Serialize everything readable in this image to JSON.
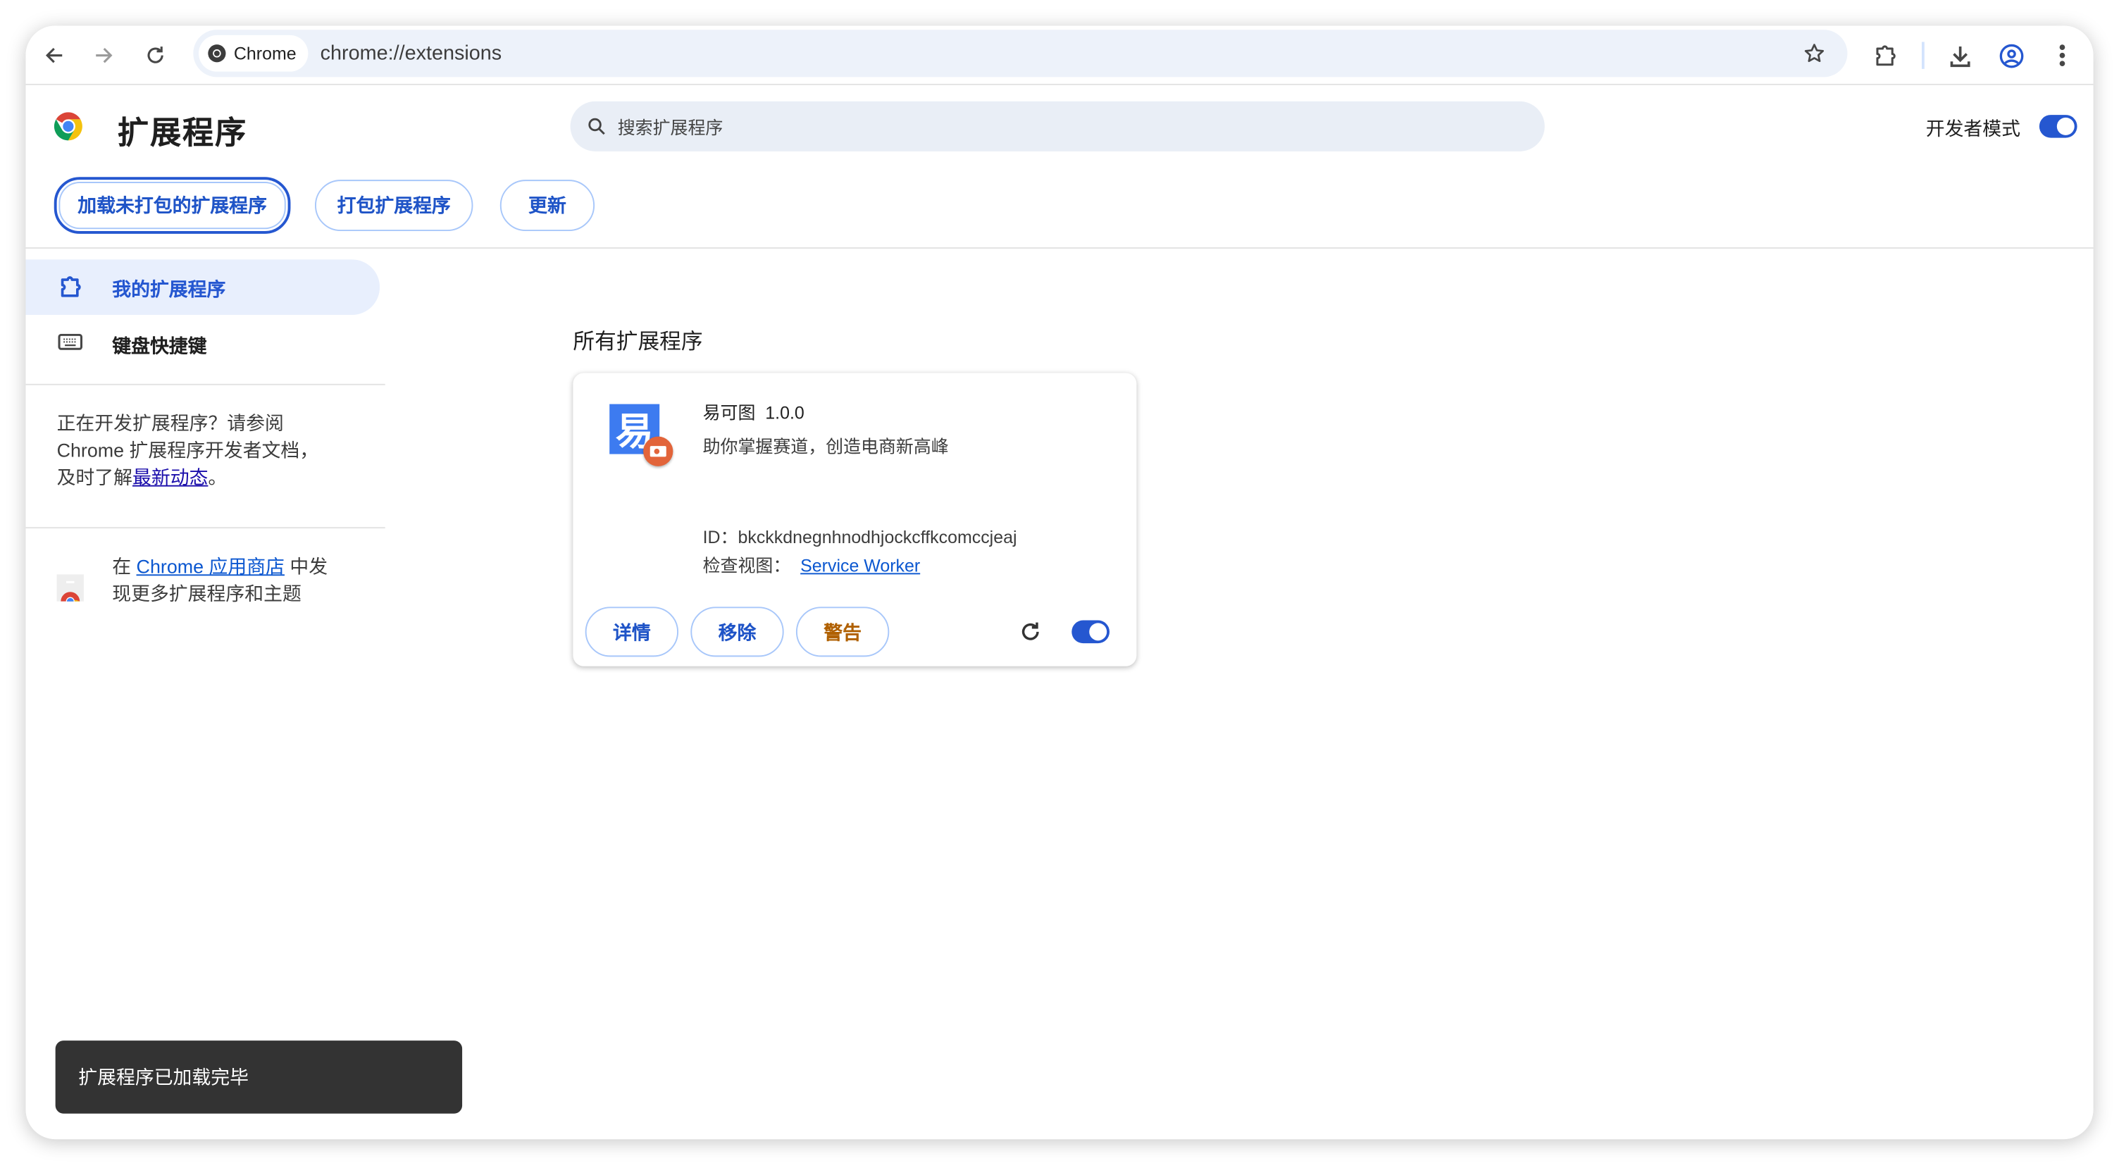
{
  "browser": {
    "chip_label": "Chrome",
    "url": "chrome://extensions"
  },
  "header": {
    "title": "扩展程序",
    "search_placeholder": "搜索扩展程序",
    "dev_mode_label": "开发者模式",
    "dev_mode_on": true
  },
  "toolbar": {
    "load_unpacked": "加载未打包的扩展程序",
    "pack": "打包扩展程序",
    "update": "更新"
  },
  "sidebar": {
    "items": [
      {
        "label": "我的扩展程序",
        "icon": "puzzle-icon",
        "selected": true
      },
      {
        "label": "键盘快捷键",
        "icon": "keyboard-icon",
        "selected": false
      }
    ],
    "dev_text_1": "正在开发扩展程序？请参阅",
    "dev_text_2": "Chrome 扩展程序开发者文档，",
    "dev_text_3": "及时了解",
    "dev_link": "最新动态",
    "dev_text_end": "。",
    "store_prefix": "在 ",
    "store_link": "Chrome 应用商店",
    "store_suffix": " 中发",
    "store_line2": "现更多扩展程序和主题"
  },
  "main": {
    "section_title": "所有扩展程序",
    "extension": {
      "name": "易可图",
      "version": "1.0.0",
      "description": "助你掌握赛道，创造电商新高峰",
      "id_label": "ID：",
      "id": "bkckkdnegnhnodhjockcffkcomccjeaj",
      "inspect_label": "检查视图：",
      "inspect_link": "Service Worker",
      "details": "详情",
      "remove": "移除",
      "warning": "警告",
      "enabled": true,
      "icon_glyph": "易"
    }
  },
  "toast": {
    "message": "扩展程序已加载完毕"
  },
  "colors": {
    "accent": "#2557d0",
    "warning": "#b06000",
    "toast_bg": "#333333"
  }
}
